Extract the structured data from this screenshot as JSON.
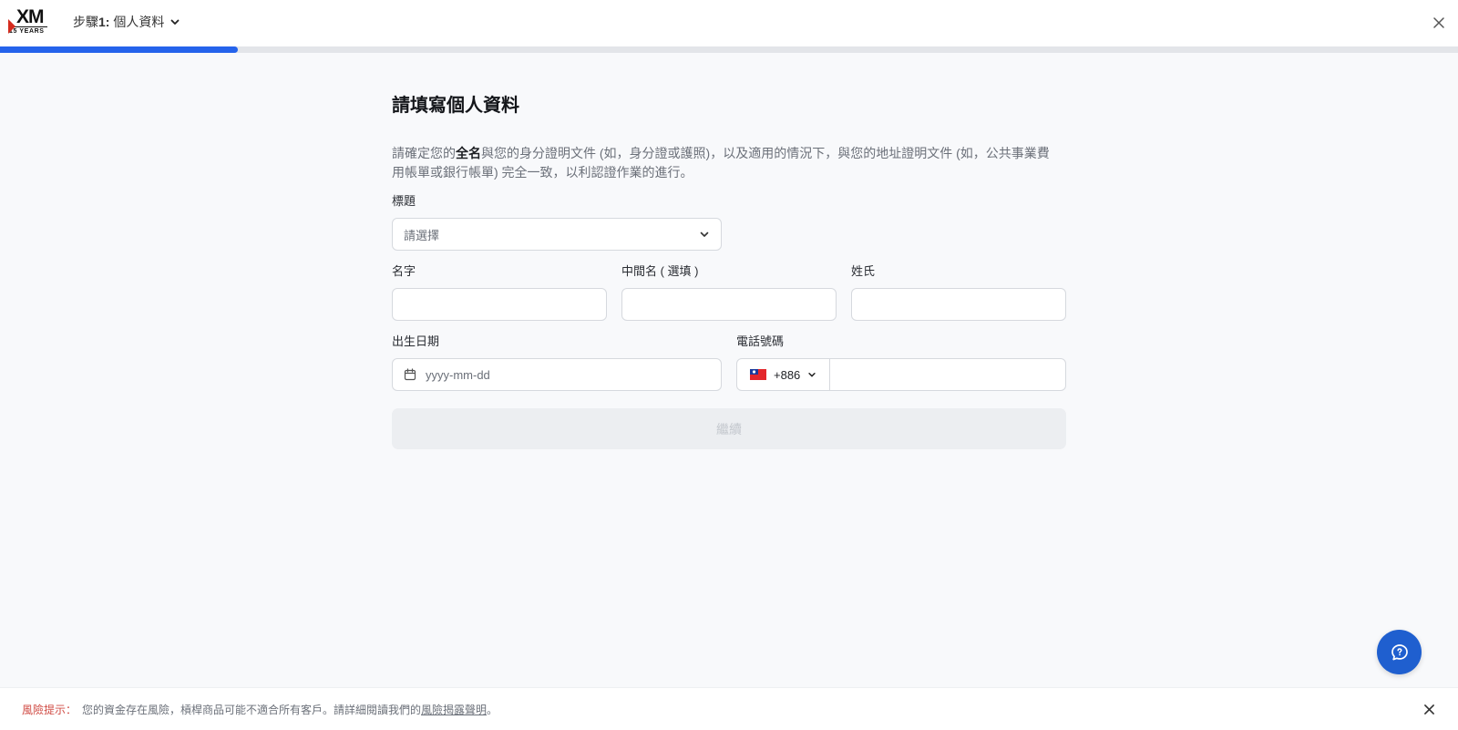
{
  "header": {
    "logo_text": "XM",
    "logo_sub": "15 YEARS",
    "step_prefix": "步驟",
    "step_number": "1:",
    "step_title": "個人資料"
  },
  "progress": {
    "fraction": 0.163
  },
  "form": {
    "title": "請填寫個人資料",
    "desc_part1": "請確定您的",
    "desc_bold": "全名",
    "desc_part2": "與您的身分證明文件 (如，身分證或護照)，以及適用的情況下，與您的地址證明文件 (如，公共事業費用帳單或銀行帳單) 完全一致，以利認證作業的進行。",
    "title_field": {
      "label": "標題",
      "placeholder": "請選擇"
    },
    "first_name": {
      "label": "名字"
    },
    "middle_name": {
      "label": "中間名 ( 選填 )"
    },
    "last_name": {
      "label": "姓氏"
    },
    "dob": {
      "label": "出生日期",
      "placeholder": "yyyy-mm-dd"
    },
    "phone": {
      "label": "電話號碼",
      "code": "+886"
    },
    "continue_label": "繼續"
  },
  "risk": {
    "label": "風險提示：",
    "text": "您的資金存在風險，槓桿商品可能不適合所有客戶。請詳細閱讀我們的",
    "link": "風險揭露聲明",
    "end": "。"
  }
}
